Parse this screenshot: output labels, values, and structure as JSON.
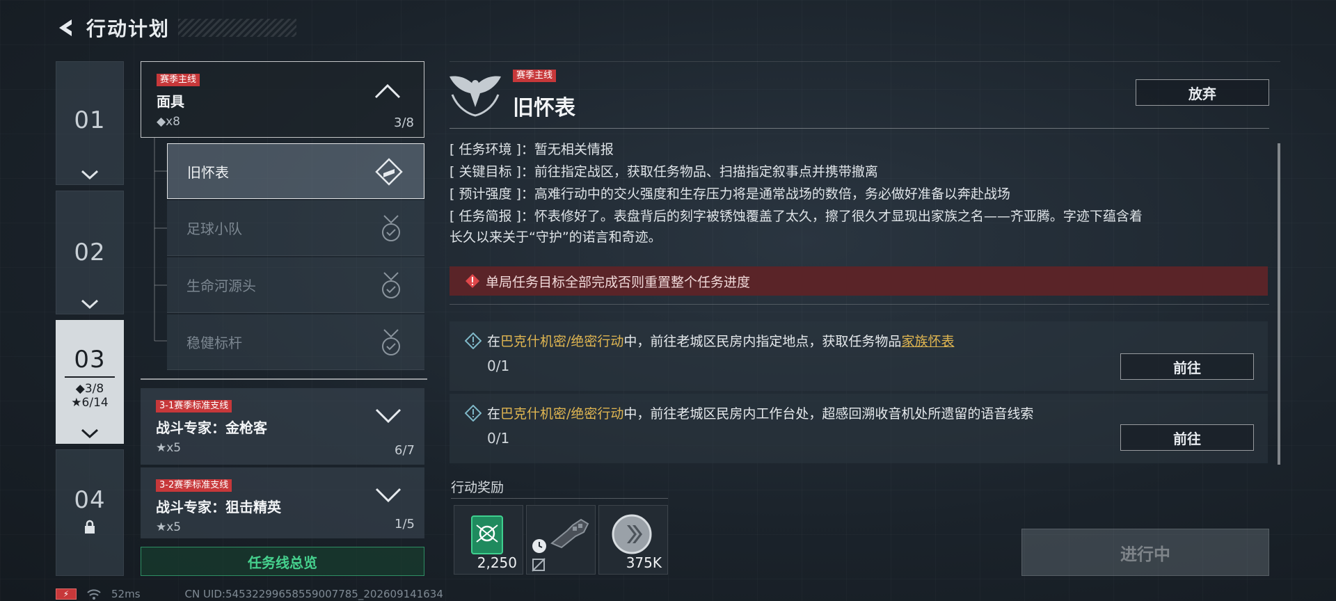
{
  "header": {
    "title": "行动计划"
  },
  "chapters": [
    {
      "num": "01"
    },
    {
      "num": "02"
    },
    {
      "num": "03",
      "diamond": "◆3/8",
      "star": "★6/14"
    },
    {
      "num": "04"
    }
  ],
  "groups": [
    {
      "tag": "赛季主线",
      "title": "面具",
      "sub": "◆x8",
      "count": "3/8"
    },
    {
      "tag": "3-1赛季标准支线",
      "title": "战斗专家：金枪客",
      "sub": "★x5",
      "count": "6/7"
    },
    {
      "tag": "3-2赛季标准支线",
      "title": "战斗专家：狙击精英",
      "sub": "★x5",
      "count": "1/5"
    }
  ],
  "sub_items": [
    {
      "label": "旧怀表"
    },
    {
      "label": "足球小队"
    },
    {
      "label": "生命河源头"
    },
    {
      "label": "稳健标杆"
    }
  ],
  "overview_button": "任务线总览",
  "detail": {
    "tag": "赛季主线",
    "title": "旧怀表",
    "abandon": "放弃",
    "env_key": "[ 任务环境 ]",
    "env_val": "：暂无相关情报",
    "goal_key": "[ 关键目标 ]",
    "goal_val": "：前往指定战区，获取任务物品、扫描指定叙事点并携带撤离",
    "intensity_key": "[ 预计强度 ]",
    "intensity_val": "：高难行动中的交火强度和生存压力将是通常战场的数倍，务必做好准备以奔赴战场",
    "brief_key": "[ 任务简报 ]",
    "brief_val": "：怀表修好了。表盘背后的刻字被锈蚀覆盖了太久，擦了很久才显现出家族之名——齐亚腾。字迹下蕴含着",
    "brief_val2": "长久以来关于“守护”的诺言和奇迹。",
    "warning": "单局任务目标全部完成否则重置整个任务进度"
  },
  "objectives": [
    {
      "pre": "在",
      "mode": "巴克什机密/绝密行动",
      "mid": "中，前往老城区民房内指定地点，获取任务物品",
      "item": "家族怀表",
      "progress": "0/1",
      "button": "前往"
    },
    {
      "pre": "在",
      "mode": "巴克什机密/绝密行动",
      "mid": "中，前往老城区民房内工作台处，超感回溯收音机处所遗留的语音线索",
      "item": "",
      "progress": "0/1",
      "button": "前往"
    }
  ],
  "rewards": {
    "label": "行动奖励",
    "items": [
      {
        "qty": "2,250",
        "icon": "drone-card-icon"
      },
      {
        "qty": "",
        "icon": "armored-glove-icon"
      },
      {
        "qty": "375K",
        "icon": "silver-coin-icon"
      }
    ]
  },
  "progress_button": "进行中",
  "status": {
    "ping": "52ms",
    "uid": "CN UID:545322996585590077​85_202609141634"
  },
  "colors": {
    "tag_red": "#c7383a",
    "highlight": "#e0b651",
    "overview_green": "#46d18e",
    "warning_bg": "#5a2428"
  }
}
